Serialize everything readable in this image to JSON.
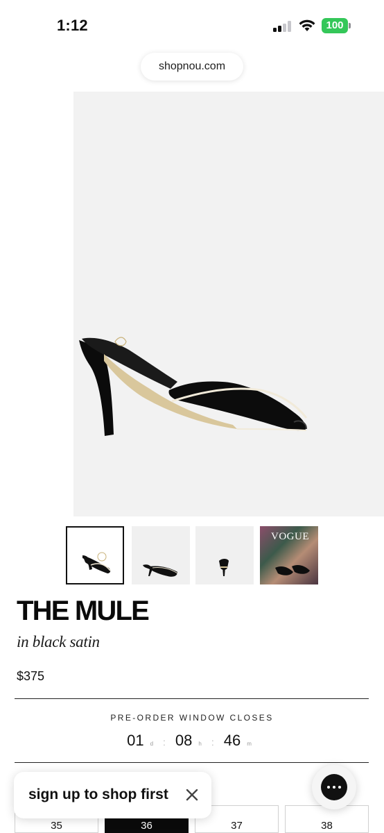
{
  "status_bar": {
    "time": "1:12",
    "battery_level": "100",
    "battery_color": "#34c759"
  },
  "browser": {
    "url": "shopnou.com"
  },
  "product": {
    "title": "THE MULE",
    "subtitle": "in black satin",
    "price": "$375",
    "thumbnails": [
      {
        "icon": "mule-side-view",
        "selected": true
      },
      {
        "icon": "mule-angle-view",
        "selected": false
      },
      {
        "icon": "mule-back-view",
        "selected": false
      },
      {
        "icon": "vogue-editorial",
        "label": "VOGUE",
        "selected": false
      }
    ]
  },
  "preorder": {
    "label": "PRE-ORDER WINDOW CLOSES",
    "days": "01",
    "days_unit": "d",
    "hours": "08",
    "hours_unit": "h",
    "minutes": "46",
    "minutes_unit": "m",
    "separator": ":"
  },
  "sizes": {
    "options": [
      "35",
      "36",
      "37",
      "38"
    ],
    "selected": "36"
  },
  "signup": {
    "text": "sign up to shop first"
  },
  "colors": {
    "accent": "#0a0a0a",
    "hero_bg": "#f2f2f2"
  }
}
